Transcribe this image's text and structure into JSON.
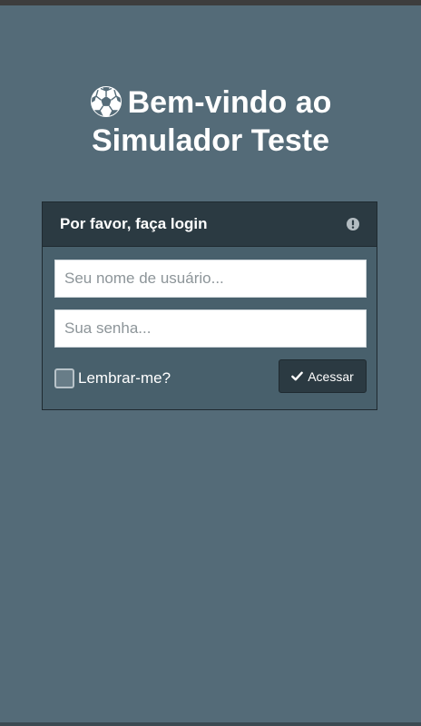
{
  "header": {
    "title_line1": "Bem-vindo ao",
    "title_line2": "Simulador Teste",
    "icon": "soccer-ball-icon"
  },
  "login_panel": {
    "title": "Por favor, faça login",
    "header_icon": "exclamation-circle-icon",
    "username_placeholder": "Seu nome de usuário...",
    "username_value": "",
    "password_placeholder": "Sua senha...",
    "password_value": "",
    "remember_label": "Lembrar-me?",
    "remember_checked": false,
    "submit_label": "Acessar",
    "submit_icon": "checkmark-icon"
  },
  "colors": {
    "background": "#546b78",
    "panel_body": "#48606c",
    "panel_header": "#2b3a42",
    "text": "#ffffff"
  }
}
